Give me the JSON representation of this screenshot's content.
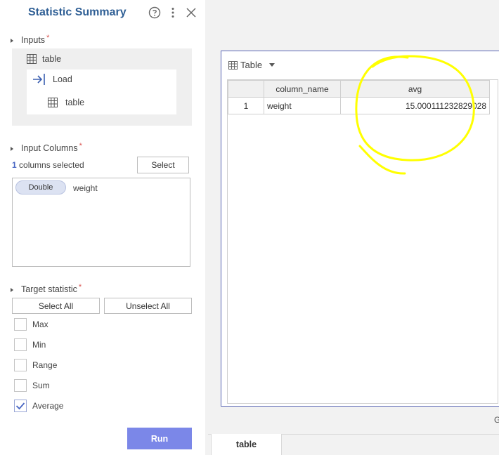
{
  "panel": {
    "title": "Statistic Summary",
    "inputs": {
      "label": "Inputs",
      "required_mark": "*",
      "table_label": "table",
      "load_label": "Load",
      "load_table_label": "table"
    },
    "input_columns": {
      "label": "Input Columns",
      "required_mark": "*",
      "count": "1",
      "count_suffix": " columns selected",
      "select_button": "Select",
      "columns": [
        {
          "type": "Double",
          "name": "weight"
        }
      ]
    },
    "target_statistic": {
      "label": "Target statistic",
      "required_mark": "*",
      "select_all": "Select All",
      "unselect_all": "Unselect All",
      "options": [
        {
          "label": "Max",
          "checked": false
        },
        {
          "label": "Min",
          "checked": false
        },
        {
          "label": "Range",
          "checked": false
        },
        {
          "label": "Sum",
          "checked": false
        },
        {
          "label": "Average",
          "checked": true
        }
      ]
    },
    "run_button": "Run"
  },
  "result": {
    "view_selector": "Table",
    "columns": [
      "",
      "column_name",
      "avg"
    ],
    "rows": [
      [
        "1",
        "weight",
        "15.000111232829028"
      ]
    ],
    "edge_text": "G",
    "tabs": [
      {
        "label": "table",
        "active": true
      }
    ]
  },
  "colors": {
    "accent": "#2f5f95",
    "run_button": "#7b87e8",
    "annotation": "#ffff00",
    "card_border": "#5a67b5"
  }
}
